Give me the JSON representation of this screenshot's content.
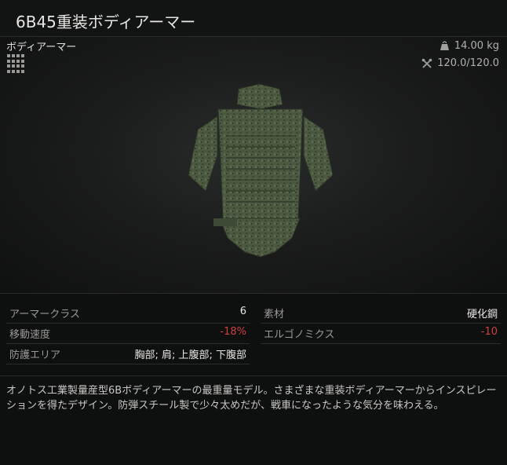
{
  "window": {
    "title": "6B45重装ボディアーマー"
  },
  "item": {
    "category": "ボディアーマー",
    "weight": "14.00 kg",
    "durability": "120.0/120.0",
    "icons": {
      "size": "grid-icon",
      "weight": "weight-icon",
      "durability": "repair-icon"
    }
  },
  "stats_left": [
    {
      "label": "アーマークラス",
      "value": "6"
    },
    {
      "label": "移動速度",
      "value": "-18%"
    },
    {
      "label": "防護エリア",
      "value": "胸部; 肩; 上腹部; 下腹部"
    }
  ],
  "stats_right": [
    {
      "label": "素材",
      "value": "硬化鋼"
    },
    {
      "label": "エルゴノミクス",
      "value": "-10"
    }
  ],
  "description": "オノトス工業製量産型6Bボディアーマーの最重量モデル。さまざまな重装ボディアーマーからインスピレーションを得たデザイン。防弾スチール製で少々太めだが、戦車になったような気分を味わえる。",
  "colors": {
    "negative": "#d04040",
    "text": "#e6e6e2",
    "background": "#0e0f0f"
  }
}
